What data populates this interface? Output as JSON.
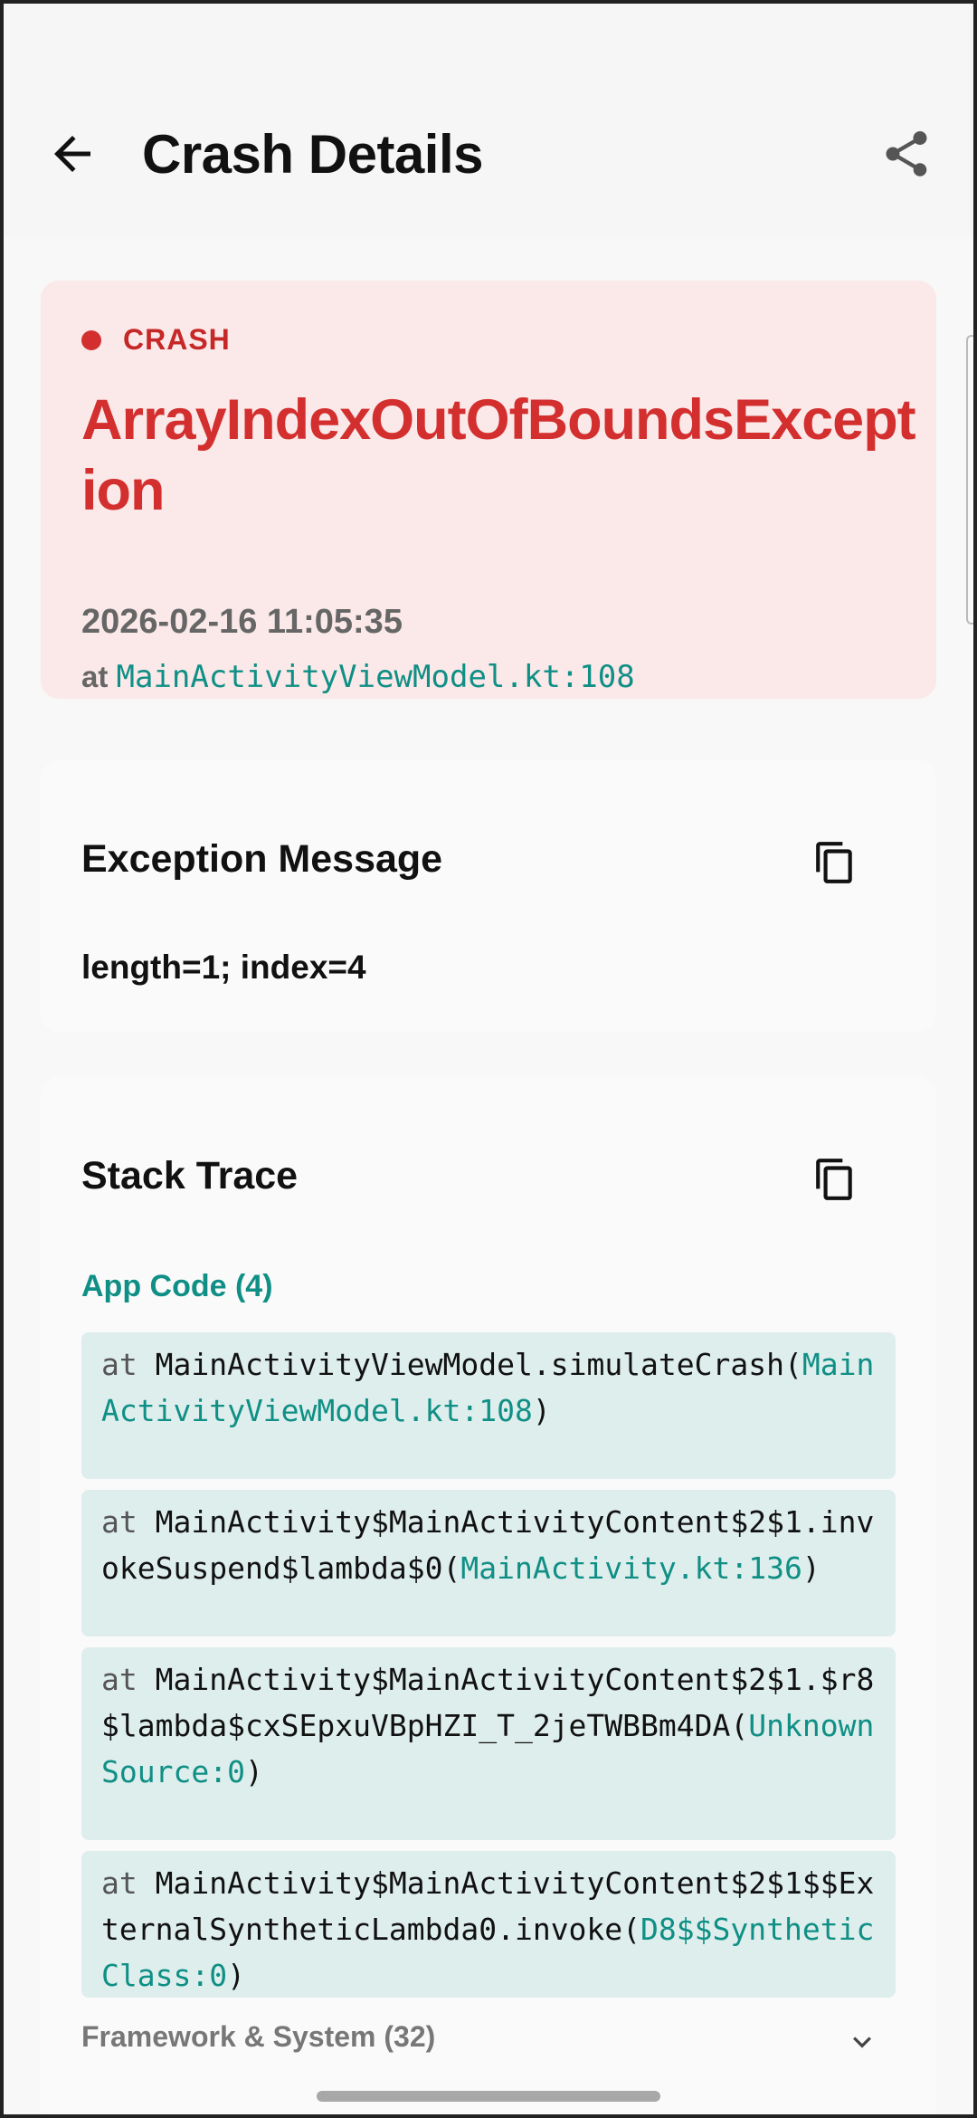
{
  "appbar": {
    "title": "Crash Details",
    "back_icon": "arrow-left-icon",
    "share_icon": "share-icon"
  },
  "crash": {
    "badge": "CRASH",
    "exception": "ArrayIndexOutOfBoundsException",
    "timestamp": "2026-02-16 11:05:35",
    "at_prefix": "at",
    "location": "MainActivityViewModel.kt:108",
    "accent_color": "#d32f2f"
  },
  "message_section": {
    "title": "Exception Message",
    "text": "length=1; index=4",
    "copy_icon": "copy-icon"
  },
  "stack_section": {
    "title": "Stack Trace",
    "copy_icon": "copy-icon",
    "app_code_label": "App Code (4)",
    "frames": [
      {
        "at": "at",
        "method": "MainActivityViewModel.simulateCrash(",
        "source": "MainActivityViewModel.kt:108",
        "close": ")"
      },
      {
        "at": "at",
        "method": "MainActivity$MainActivityContent$2$1.invokeSuspend$lambda$0(",
        "source": "MainActivity.kt:136",
        "close": ")"
      },
      {
        "at": "at",
        "method": "MainActivity$MainActivityContent$2$1.$r8$lambda$cxSEpxuVBpHZI_T_2jeTWBBm4DA(",
        "source": "Unknown Source:0",
        "close": ")"
      },
      {
        "at": "at",
        "method": "MainActivity$MainActivityContent$2$1$$ExternalSyntheticLambda0.invoke(",
        "source": "D8$$SyntheticClass:0",
        "close": ")"
      }
    ],
    "framework_label": "Framework & System (32)",
    "expand_icon": "chevron-down-icon",
    "source_color": "#0f8f85"
  }
}
